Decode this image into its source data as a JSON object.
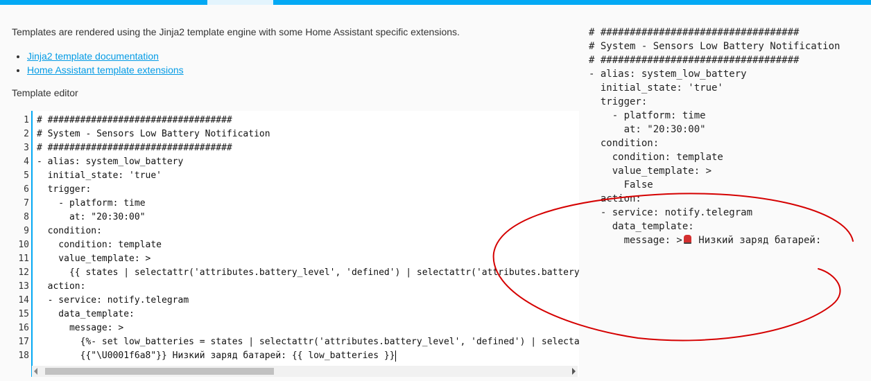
{
  "intro_text": "Templates are rendered using the Jinja2 template engine with some Home Assistant specific extensions.",
  "links": [
    {
      "label": "Jinja2 template documentation"
    },
    {
      "label": "Home Assistant template extensions"
    }
  ],
  "editor_label": "Template editor",
  "editor": {
    "line_numbers": [
      "1",
      "2",
      "3",
      "4",
      "5",
      "6",
      "7",
      "8",
      "9",
      "10",
      "11",
      "12",
      "13",
      "14",
      "15",
      "16",
      "17",
      "18"
    ],
    "lines": [
      "# ##################################",
      "# System - Sensors Low Battery Notification",
      "# ##################################",
      "- alias: system_low_battery",
      "  initial_state: 'true'",
      "  trigger:",
      "    - platform: time",
      "      at: \"20:30:00\"",
      "  condition:",
      "    condition: template",
      "    value_template: >",
      "      {{ states | selectattr('attributes.battery_level', 'defined') | selectattr('attributes.battery_l",
      "  action:",
      "  - service: notify.telegram",
      "    data_template:",
      "      message: >",
      "        {%- set low_batteries = states | selectattr('attributes.battery_level', 'defined') | selectatt",
      "        {{\"\\U0001f6a8\"}} Низкий заряд батарей: {{ low_batteries }}"
    ]
  },
  "output": {
    "lines": [
      "# ##################################",
      "# System - Sensors Low Battery Notification",
      "# ##################################",
      "- alias: system_low_battery",
      "  initial_state: 'true'",
      "  trigger:",
      "    - platform: time",
      "      at: \"20:30:00\"",
      "  condition:",
      "    condition: template",
      "    value_template: >",
      "      False",
      "  action:",
      "  - service: notify.telegram",
      "    data_template:"
    ],
    "message_prefix": "      message: >",
    "message_icon": "police-car-light-icon",
    "message_text": " Низкий заряд батарей:"
  },
  "colors": {
    "accent": "#03a9f4",
    "link": "#039be5",
    "annotation": "#d50000"
  }
}
